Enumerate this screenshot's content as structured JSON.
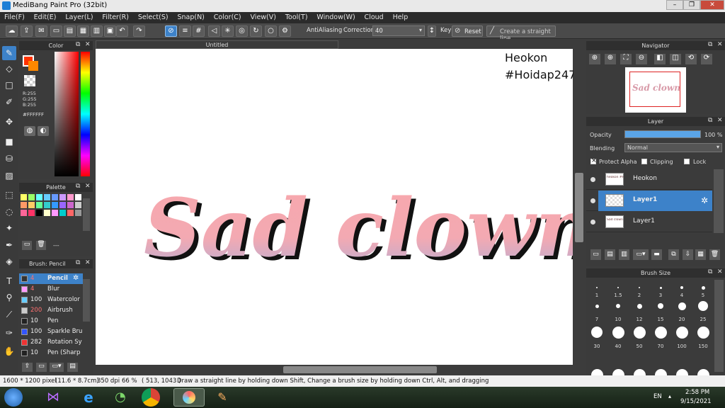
{
  "app": {
    "title": "MediBang Paint Pro (32bit)"
  },
  "menu": [
    "File(F)",
    "Edit(E)",
    "Layer(L)",
    "Filter(R)",
    "Select(S)",
    "Snap(N)",
    "Color(C)",
    "View(V)",
    "Tool(T)",
    "Window(W)",
    "Cloud",
    "Help"
  ],
  "toolbar": {
    "antialiasing_label": "AntiAliasing",
    "correction_label": "Correction",
    "correction_value": "40",
    "key_label": "Key",
    "reset_label": "Reset",
    "straight_line_label": "Create a straight line"
  },
  "color_panel": {
    "title": "Color",
    "r": "R:255",
    "g": "G:255",
    "b": "B:255",
    "hex": "#FFFFFF"
  },
  "palette_panel": {
    "title": "Palette",
    "dash": "---",
    "colors": [
      "#ffff66",
      "#99ff66",
      "#66ffff",
      "#66ccff",
      "#6699ff",
      "#cc99ff",
      "#ff99cc",
      "#ffffff",
      "#ff9966",
      "#ffcc66",
      "#66ff99",
      "#33cccc",
      "#3399ff",
      "#9966ff",
      "#cc66cc",
      "#cccccc",
      "#ff6699",
      "#ff3366",
      "#000000",
      "#ffffcc",
      "#ff99ff",
      "#00cccc",
      "#ff6666",
      "#999999"
    ]
  },
  "brush_panel": {
    "title": "Brush: Pencil",
    "brushes": [
      {
        "size": "4",
        "name": "Pencil",
        "swatch": "#333333",
        "selected": true
      },
      {
        "size": "4",
        "name": "Blur",
        "swatch": "#ff99ff",
        "selected": false
      },
      {
        "size": "100",
        "name": "Watercolor",
        "swatch": "#66ccff",
        "selected": false
      },
      {
        "size": "200",
        "name": "Airbrush",
        "swatch": "#cccccc",
        "selected": false
      },
      {
        "size": "10",
        "name": "Pen",
        "swatch": "#222222",
        "selected": false
      },
      {
        "size": "100",
        "name": "Sparkle Bru",
        "swatch": "#3355ff",
        "selected": false
      },
      {
        "size": "282",
        "name": "Rotation Sy",
        "swatch": "#ee3333",
        "selected": false
      },
      {
        "size": "10",
        "name": "Pen (Sharp",
        "swatch": "#222222",
        "selected": false
      }
    ]
  },
  "canvas": {
    "tab_title": "Untitled",
    "watermark_line1": "Heokon",
    "watermark_line2": "#Hoidap247",
    "artwork_text": "Sad clown"
  },
  "navigator": {
    "title": "Navigator",
    "thumb_text": "Sad clown"
  },
  "layer_panel": {
    "title": "Layer",
    "opacity_label": "Opacity",
    "opacity_value": "100 %",
    "opacity_fraction": 1.0,
    "blending_label": "Blending",
    "blending_value": "Normal",
    "protect_alpha_label": "Protect Alpha",
    "clipping_label": "Clipping",
    "lock_label": "Lock",
    "layers": [
      {
        "name": "Heokon",
        "selected": false,
        "thumb_text": "heokon #Hoidap247"
      },
      {
        "name": "Layer1",
        "selected": true,
        "thumb_text": ""
      },
      {
        "name": "Layer1",
        "selected": false,
        "thumb_text": "Sad clown"
      }
    ]
  },
  "brush_size_panel": {
    "title": "Brush Size",
    "sizes": [
      "1",
      "1.5",
      "2",
      "3",
      "4",
      "5",
      "7",
      "10",
      "12",
      "15",
      "20",
      "25",
      "30",
      "40",
      "50",
      "70",
      "100",
      "150"
    ]
  },
  "status": {
    "size": "1600 * 1200 pixel",
    "dims": "(11.6 * 8.7cm)",
    "dpi": "350 dpi",
    "zoom": "66 %",
    "coords": "( 513, 1043 )",
    "hint": "Draw a straight line by holding down Shift, Change a brush size by holding down Ctrl, Alt, and dragging"
  },
  "taskbar": {
    "lang": "EN",
    "time": "2:58 PM",
    "date": "9/15/2021"
  },
  "colors": {
    "accent": "#3d82c9",
    "text_gradient_top": "#f8a8ad",
    "text_gradient_bottom": "#b3aed6"
  }
}
